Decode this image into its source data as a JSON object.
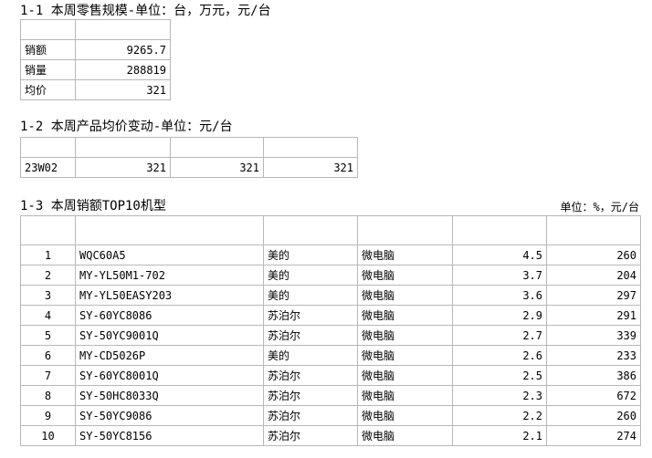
{
  "section1": {
    "title": "1-1 本周零售规模-单位：台，万元，元/台",
    "rows": [
      {
        "label": "销额",
        "value": "9265.7"
      },
      {
        "label": "销量",
        "value": "288819"
      },
      {
        "label": "均价",
        "value": "321"
      }
    ]
  },
  "section2": {
    "title": "1-2 本周产品均价变动-单位：元/台",
    "row": {
      "week": "23W02",
      "values": [
        "321",
        "321",
        "321"
      ]
    }
  },
  "section3": {
    "title": "1-3 本周销额TOP10机型",
    "unit": "单位：%，元/台",
    "rows": [
      {
        "rank": "1",
        "model": "WQC60A5",
        "brand": "美的",
        "category": "微电脑",
        "share": "4.5",
        "price": "260"
      },
      {
        "rank": "2",
        "model": "MY-YL50M1-702",
        "brand": "美的",
        "category": "微电脑",
        "share": "3.7",
        "price": "204"
      },
      {
        "rank": "3",
        "model": "MY-YL50EASY203",
        "brand": "美的",
        "category": "微电脑",
        "share": "3.6",
        "price": "297"
      },
      {
        "rank": "4",
        "model": "SY-60YC8086",
        "brand": "苏泊尔",
        "category": "微电脑",
        "share": "2.9",
        "price": "291"
      },
      {
        "rank": "5",
        "model": "SY-50YC9001Q",
        "brand": "苏泊尔",
        "category": "微电脑",
        "share": "2.7",
        "price": "339"
      },
      {
        "rank": "6",
        "model": "MY-CD5026P",
        "brand": "美的",
        "category": "微电脑",
        "share": "2.6",
        "price": "233"
      },
      {
        "rank": "7",
        "model": "SY-60YC8001Q",
        "brand": "苏泊尔",
        "category": "微电脑",
        "share": "2.5",
        "price": "386"
      },
      {
        "rank": "8",
        "model": "SY-50HC8033Q",
        "brand": "苏泊尔",
        "category": "微电脑",
        "share": "2.3",
        "price": "672"
      },
      {
        "rank": "9",
        "model": "SY-50YC9086",
        "brand": "苏泊尔",
        "category": "微电脑",
        "share": "2.2",
        "price": "260"
      },
      {
        "rank": "10",
        "model": "SY-50YC8156",
        "brand": "苏泊尔",
        "category": "微电脑",
        "share": "2.1",
        "price": "274"
      }
    ]
  }
}
